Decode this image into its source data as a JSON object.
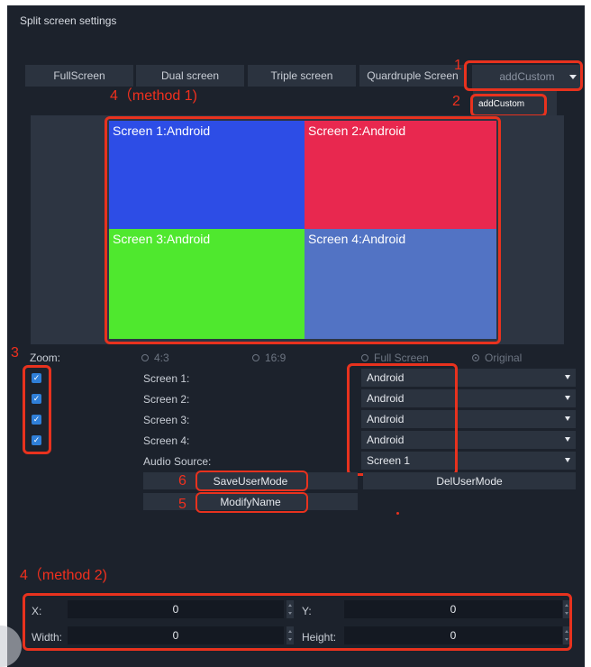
{
  "window": {
    "title": "Split screen settings"
  },
  "modes": [
    {
      "label": "FullScreen"
    },
    {
      "label": "Dual screen"
    },
    {
      "label": "Triple screen"
    },
    {
      "label": "Quardruple Screen"
    }
  ],
  "custom_dropdown": {
    "value": "addCustom",
    "popup_item": "addCustom"
  },
  "annotations": {
    "n1": "1",
    "n2": "2",
    "n3": "3",
    "n4_method1": "4（method 1)",
    "n4_method2": "4（method 2)",
    "n5": "5",
    "n6": "6"
  },
  "preview": {
    "screens": [
      {
        "label": "Screen 1:Android",
        "color": "#2d4de6"
      },
      {
        "label": "Screen 2:Android",
        "color": "#e8284f"
      },
      {
        "label": "Screen 3:Android",
        "color": "#4fe82e"
      },
      {
        "label": "Screen 4:Android",
        "color": "#5273c4"
      }
    ]
  },
  "zoom": {
    "label": "Zoom:",
    "options": [
      "4:3",
      "16:9",
      "Full Screen",
      "Original"
    ],
    "selected": "Original"
  },
  "screens_config": [
    {
      "label": "Screen 1:",
      "checked": true,
      "source": "Android"
    },
    {
      "label": "Screen 2:",
      "checked": true,
      "source": "Android"
    },
    {
      "label": "Screen 3:",
      "checked": true,
      "source": "Android"
    },
    {
      "label": "Screen 4:",
      "checked": true,
      "source": "Android"
    }
  ],
  "audio": {
    "label": "Audio Source:",
    "value": "Screen 1"
  },
  "buttons": {
    "save": "SaveUserMode",
    "del": "DelUserMode",
    "modify": "ModifyName"
  },
  "position": {
    "x_label": "X:",
    "x_value": "0",
    "y_label": "Y:",
    "y_value": "0",
    "width_label": "Width:",
    "width_value": "0",
    "height_label": "Height:",
    "height_value": "0"
  },
  "colors": {
    "annotation": "#e8321e",
    "checkbox": "#2f7fd8",
    "panel": "#1c222c"
  }
}
